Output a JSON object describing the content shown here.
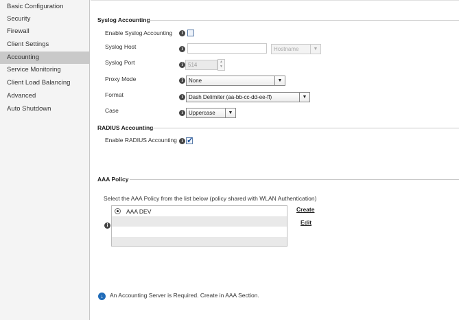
{
  "sidebar": {
    "items": [
      {
        "label": "Basic Configuration"
      },
      {
        "label": "Security"
      },
      {
        "label": "Firewall"
      },
      {
        "label": "Client Settings"
      },
      {
        "label": "Accounting",
        "active": true
      },
      {
        "label": "Service Monitoring"
      },
      {
        "label": "Client Load Balancing"
      },
      {
        "label": "Advanced"
      },
      {
        "label": "Auto Shutdown"
      }
    ]
  },
  "syslog": {
    "title": "Syslog Accounting",
    "enable_label": "Enable Syslog Accounting",
    "enable_checked": false,
    "host_label": "Syslog Host",
    "host_value": "",
    "host_type": "Hostname",
    "port_label": "Syslog Port",
    "port_value": "514",
    "proxy_label": "Proxy Mode",
    "proxy_value": "None",
    "format_label": "Format",
    "format_value": "Dash Delimiter (aa-bb-cc-dd-ee-ff)",
    "case_label": "Case",
    "case_value": "Uppercase"
  },
  "radius": {
    "title": "RADIUS Accounting",
    "enable_label": "Enable RADIUS Accounting",
    "enable_checked": true
  },
  "aaa": {
    "title": "AAA Policy",
    "instruction": "Select the AAA Policy from the list below  (policy shared with WLAN Authentication)",
    "policies": [
      {
        "name": "AAA DEV",
        "selected": true
      }
    ],
    "create_label": "Create",
    "edit_label": "Edit"
  },
  "footer": {
    "notice": "An Accounting Server is Required.  Create in AAA Section.",
    "icon": "down-arrow-icon"
  },
  "icons": {
    "info": "i",
    "dropdown": "▼",
    "spin_up": "▲",
    "spin_down": "▼",
    "notice_arrow": "↓"
  },
  "colors": {
    "active_sidebar": "#c9c9c9",
    "checkbox": "#1c4f9c",
    "notice_icon": "#1f6bb8"
  }
}
